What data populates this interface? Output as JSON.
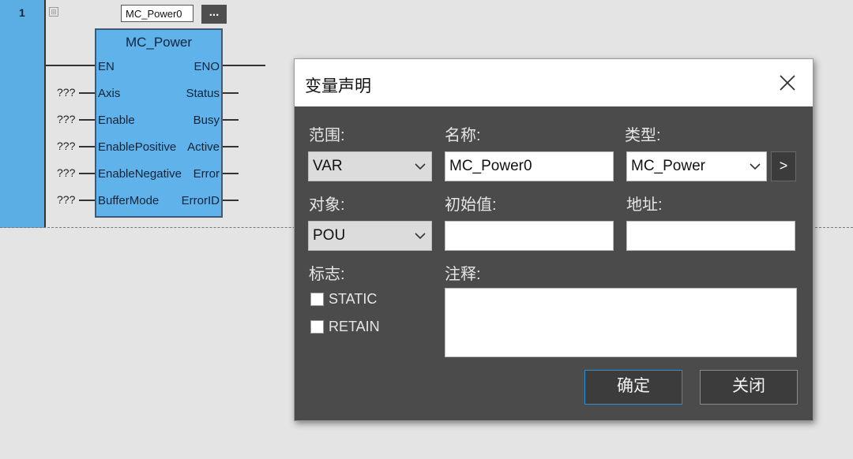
{
  "editor": {
    "rung_number": "1",
    "instance_name": "MC_Power0",
    "browse_label": "...",
    "function_block": {
      "title": "MC_Power",
      "inputs": [
        "EN",
        "Axis",
        "Enable",
        "EnablePositive",
        "EnableNegative",
        "BufferMode"
      ],
      "outputs": [
        "ENO",
        "Status",
        "Busy",
        "Active",
        "Error",
        "ErrorID"
      ],
      "unassigned_value": "???"
    }
  },
  "dialog": {
    "title": "变量声明",
    "scope": {
      "label": "范围:",
      "value": "VAR"
    },
    "name": {
      "label": "名称:",
      "value": "MC_Power0"
    },
    "type": {
      "label": "类型:",
      "value": "MC_Power",
      "browse_label": ">"
    },
    "object": {
      "label": "对象:",
      "value": "POU"
    },
    "initial_value": {
      "label": "初始值:",
      "value": ""
    },
    "address": {
      "label": "地址:",
      "value": ""
    },
    "flags": {
      "label": "标志:",
      "static_label": "STATIC",
      "retain_label": "RETAIN",
      "static_checked": false,
      "retain_checked": false
    },
    "comment": {
      "label": "注释:",
      "value": ""
    },
    "ok_label": "确定",
    "close_label": "关闭"
  }
}
